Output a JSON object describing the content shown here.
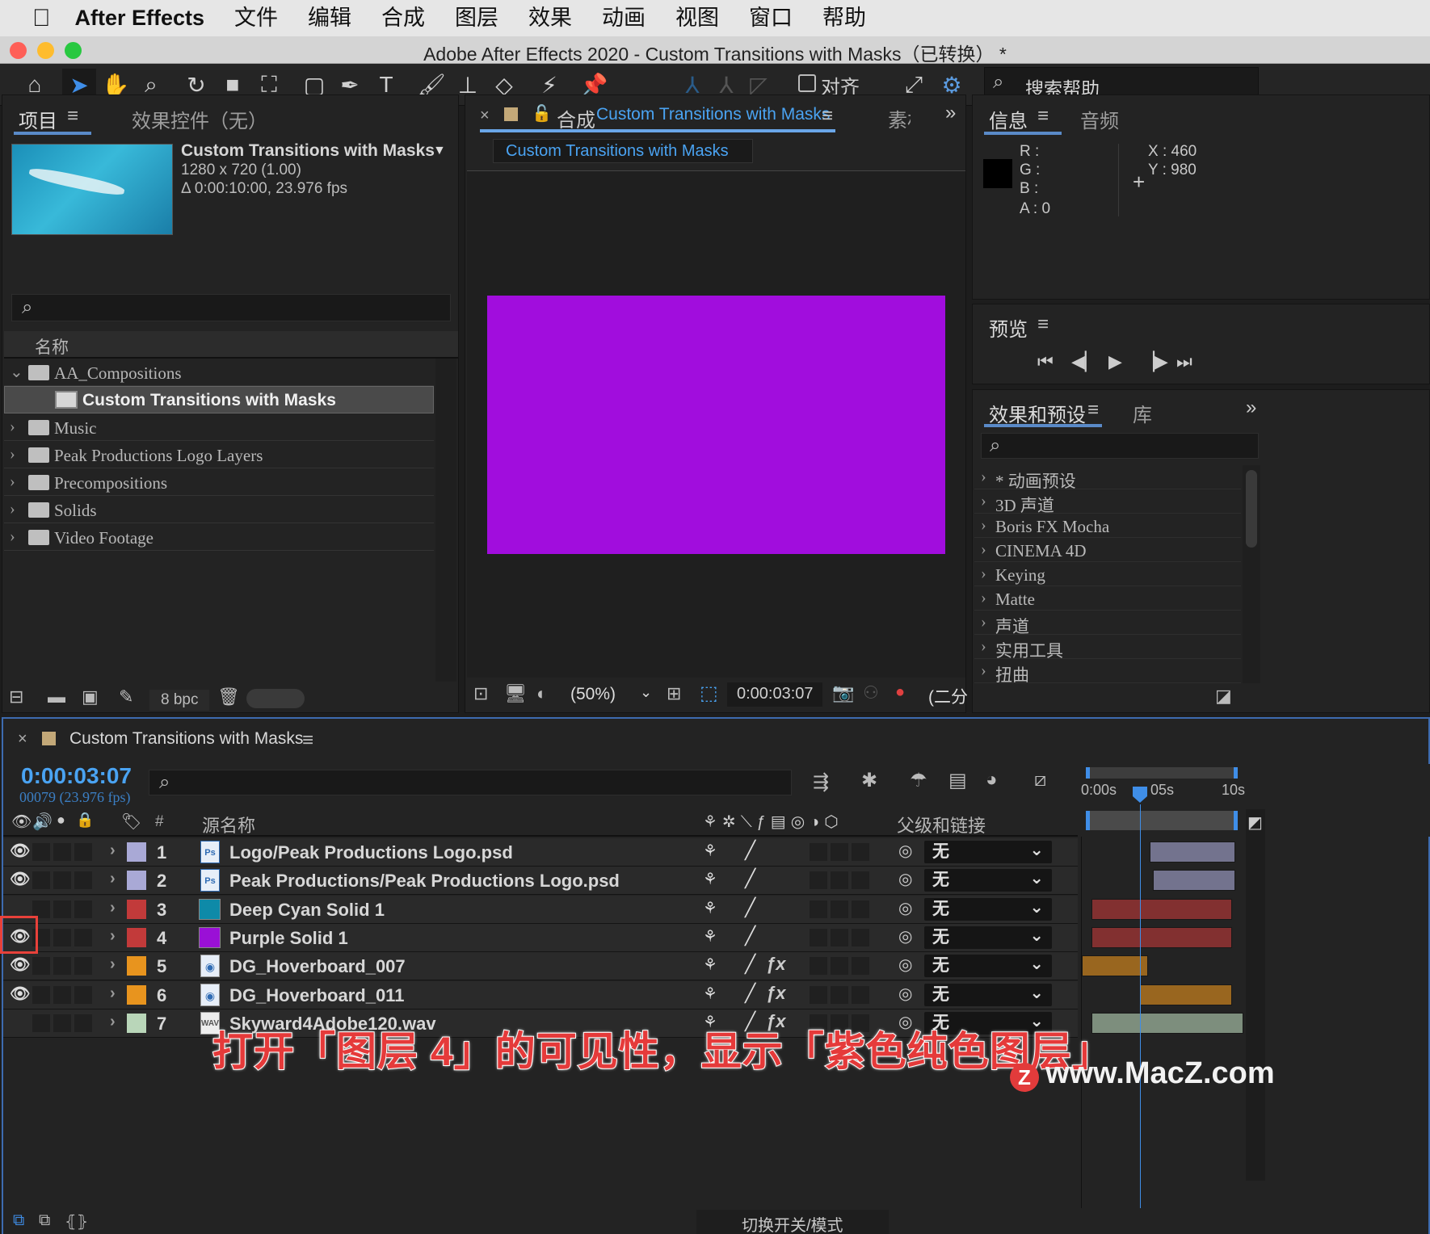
{
  "menubar": {
    "app_name": "After Effects",
    "items": [
      "文件",
      "编辑",
      "合成",
      "图层",
      "效果",
      "动画",
      "视图",
      "窗口",
      "帮助"
    ]
  },
  "window": {
    "title": "Adobe After Effects 2020 - Custom Transitions with Masks（已转换） *"
  },
  "toolbar": {
    "snap_label": "对齐",
    "search_help": "搜索帮助"
  },
  "project_panel": {
    "tab_project": "项目",
    "tab_effect_controls": "效果控件（无）",
    "comp_name": "Custom Transitions with Masks",
    "comp_size": "1280 x 720 (1.00)",
    "comp_duration": "Δ 0:00:10:00, 23.976 fps",
    "column_name": "名称",
    "items": [
      {
        "label": "AA_Compositions",
        "type": "folder",
        "expanded": true
      },
      {
        "label": "Custom Transitions with Masks",
        "type": "comp",
        "selected": true
      },
      {
        "label": "Music",
        "type": "folder"
      },
      {
        "label": "Peak Productions Logo Layers",
        "type": "folder"
      },
      {
        "label": "Precompositions",
        "type": "folder"
      },
      {
        "label": "Solids",
        "type": "folder"
      },
      {
        "label": "Video Footage",
        "type": "folder"
      }
    ],
    "bpc": "8 bpc"
  },
  "comp_panel": {
    "tab_prefix": "合成",
    "tab_name": "Custom Transitions with Masks",
    "tab_footage": "素材",
    "sub_tab": "Custom Transitions with Masks",
    "zoom": "(50%)",
    "timecode": "0:00:03:07",
    "resolution": "(二分",
    "canvas_color": "#a10ddd"
  },
  "info_panel": {
    "tab_info": "信息",
    "tab_audio": "音频",
    "r_label": "R :",
    "g_label": "G :",
    "b_label": "B :",
    "a_label": "A : 0",
    "x_label": "X : 460",
    "y_label": "Y : 980"
  },
  "preview_panel": {
    "title": "预览"
  },
  "effects_panel": {
    "tab_effects": "效果和预设",
    "tab_library": "库",
    "items": [
      "* 动画预设",
      "3D 声道",
      "Boris FX Mocha",
      "CINEMA 4D",
      "Keying",
      "Matte",
      "声道",
      "实用工具",
      "扭曲"
    ]
  },
  "timeline": {
    "comp_name": "Custom Transitions with Masks",
    "timecode": "0:00:03:07",
    "frame_info": "00079 (23.976 fps)",
    "col_num": "#",
    "col_source": "源名称",
    "col_parent": "父级和链接",
    "ruler": [
      "0:00s",
      "05s",
      "10s"
    ],
    "toggle_label": "切换开关/模式",
    "layers": [
      {
        "num": "1",
        "name": "Logo/Peak Productions Logo.psd",
        "label_color": "#a9a9d6",
        "icon": "psd",
        "visible": true,
        "fx": false,
        "parent": "无"
      },
      {
        "num": "2",
        "name": "Peak Productions/Peak Productions Logo.psd",
        "label_color": "#a9a9d6",
        "icon": "psd",
        "visible": true,
        "fx": false,
        "parent": "无"
      },
      {
        "num": "3",
        "name": "Deep Cyan Solid 1",
        "label_color": "#c23a3a",
        "icon": "solid",
        "icon_color": "#0e8aa8",
        "visible": false,
        "fx": false,
        "parent": "无"
      },
      {
        "num": "4",
        "name": "Purple Solid 1",
        "label_color": "#c23a3a",
        "icon": "solid",
        "icon_color": "#9a10d6",
        "visible": true,
        "fx": false,
        "parent": "无"
      },
      {
        "num": "5",
        "name": "DG_Hoverboard_007",
        "label_color": "#e8941e",
        "icon": "footage",
        "visible": true,
        "fx": true,
        "parent": "无"
      },
      {
        "num": "6",
        "name": "DG_Hoverboard_011",
        "label_color": "#e8941e",
        "icon": "footage",
        "visible": true,
        "fx": true,
        "parent": "无"
      },
      {
        "num": "7",
        "name": "Skyward4Adobe120.wav",
        "label_color": "#b9d6b9",
        "icon": "audio",
        "visible": false,
        "fx": true,
        "parent": "无"
      }
    ]
  },
  "caption": "打开「图层 4」的可见性，显示「紫色纯色图层」",
  "watermark": "www.MacZ.com"
}
